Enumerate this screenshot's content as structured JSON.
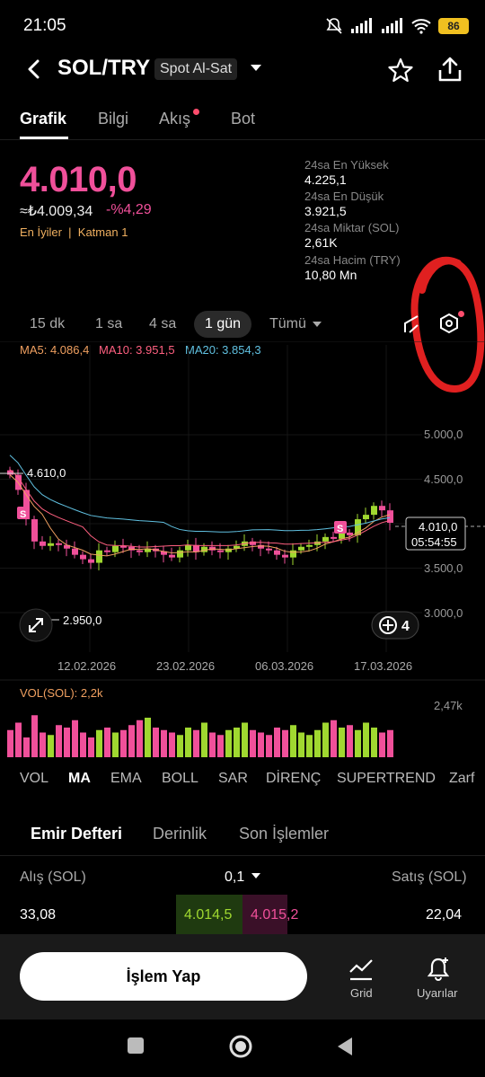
{
  "status": {
    "time": "21:05",
    "battery": "86"
  },
  "header": {
    "pair": "SOL/TRY",
    "market": "Spot Al-Sat"
  },
  "tabs": [
    {
      "label": "Grafik",
      "active": true
    },
    {
      "label": "Bilgi"
    },
    {
      "label": "Akış",
      "dot": true
    },
    {
      "label": "Bot"
    }
  ],
  "price": {
    "last": "4.010,0",
    "approx": "≈₺4.009,34",
    "change": "-%4,29",
    "tags": "En İyiler  |  Katman 1"
  },
  "stats": [
    {
      "label": "24sa En Yüksek",
      "value": "4.225,1"
    },
    {
      "label": "24sa En Düşük",
      "value": "3.921,5"
    },
    {
      "label": "24sa Miktar (SOL)",
      "value": "2,61K"
    },
    {
      "label": "24sa Hacim (TRY)",
      "value": "10,80 Mn"
    }
  ],
  "intervals": [
    "15 dk",
    "1 sa",
    "4 sa",
    "1 gün",
    "Tümü"
  ],
  "active_interval": "1 gün",
  "ma": {
    "ma5": "MA5: 4.086,4",
    "ma10": "MA10: 3.951,5",
    "ma20": "MA20: 3.854,3",
    "colors": {
      "ma5": "#f0a060",
      "ma10": "#ff6080",
      "ma20": "#60c0e0"
    }
  },
  "chart_data": {
    "type": "candlestick",
    "y_ticks": [
      "5.000,0",
      "4.500,0",
      "4.000,0",
      "3.500,0",
      "3.000,0"
    ],
    "x_ticks": [
      "12.02.2026",
      "23.02.2026",
      "06.03.2026",
      "17.03.2026"
    ],
    "high_marker": "4.610,0",
    "low_marker": "2.950,0",
    "current_price": "4.010,0",
    "countdown": "05:54:55",
    "badge_count": "4",
    "volume_label": "VOL(SOL): 2,2k",
    "volume_max": "2,47k",
    "colors": {
      "up": "#a0d830",
      "down": "#f0509a"
    }
  },
  "indicators": [
    "VOL",
    "MA",
    "EMA",
    "BOLL",
    "SAR",
    "DİRENÇ",
    "SUPERTREND",
    "Zarf"
  ],
  "active_indicator": "MA",
  "orderbook": {
    "tabs": [
      "Emir Defteri",
      "Derinlik",
      "Son İşlemler"
    ],
    "buy_label": "Alış (SOL)",
    "step": "0,1",
    "sell_label": "Satış (SOL)",
    "row": {
      "buy_qty": "33,08",
      "buy_price": "4.014,5",
      "sell_price": "4.015,2",
      "sell_qty": "22,04"
    }
  },
  "bottom": {
    "trade": "İşlem Yap",
    "grid": "Grid",
    "alerts": "Uyarılar"
  }
}
